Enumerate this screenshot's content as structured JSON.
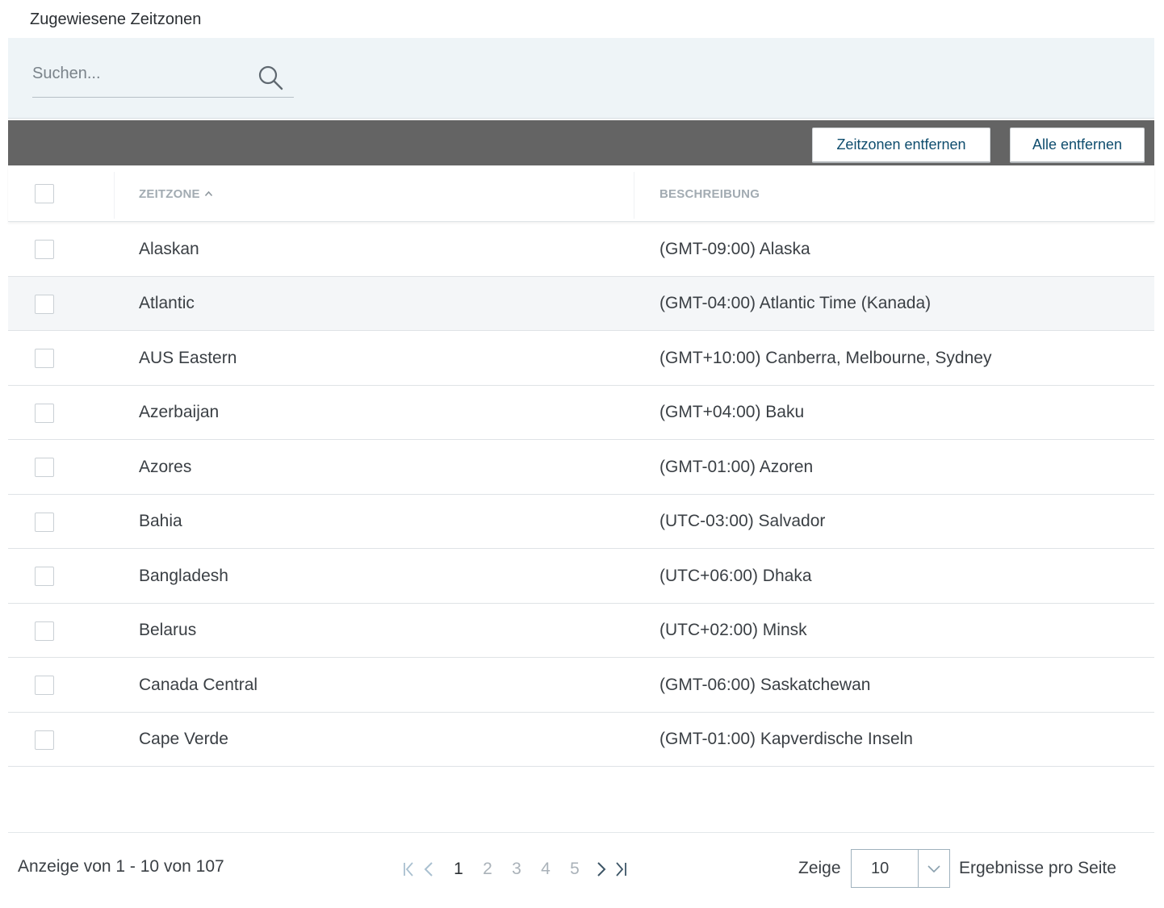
{
  "title": "Zugewiesene Zeitzonen",
  "search": {
    "placeholder": "Suchen..."
  },
  "toolbar": {
    "remove_label": "Zeitzonen entfernen",
    "remove_all_label": "Alle entfernen"
  },
  "table": {
    "columns": {
      "zone": "ZEITZONE",
      "description": "BESCHREIBUNG"
    },
    "sort": {
      "column": "zone",
      "direction": "ascending"
    },
    "rows": [
      {
        "zone": "Alaskan",
        "description": "(GMT-09:00) Alaska"
      },
      {
        "zone": "Atlantic",
        "description": "(GMT-04:00) Atlantic Time (Kanada)"
      },
      {
        "zone": "AUS Eastern",
        "description": "(GMT+10:00) Canberra, Melbourne, Sydney"
      },
      {
        "zone": "Azerbaijan",
        "description": "(GMT+04:00) Baku"
      },
      {
        "zone": "Azores",
        "description": "(GMT-01:00) Azoren"
      },
      {
        "zone": "Bahia",
        "description": "(UTC-03:00) Salvador"
      },
      {
        "zone": "Bangladesh",
        "description": "(UTC+06:00) Dhaka"
      },
      {
        "zone": "Belarus",
        "description": "(UTC+02:00) Minsk"
      },
      {
        "zone": "Canada Central",
        "description": "(GMT-06:00) Saskatchewan"
      },
      {
        "zone": "Cape Verde",
        "description": "(GMT-01:00) Kapverdische Inseln"
      }
    ]
  },
  "footer": {
    "showing": "Anzeige von 1 - 10 von 107",
    "pages": [
      "1",
      "2",
      "3",
      "4",
      "5"
    ],
    "current_page": "1",
    "show_label": "Zeige",
    "page_size": "10",
    "per_page_label": "Ergebnisse pro Seite"
  },
  "colors": {
    "toolbar_bg": "#646464",
    "search_panel_bg": "#eef4f7",
    "button_text": "#0f4d6e"
  }
}
